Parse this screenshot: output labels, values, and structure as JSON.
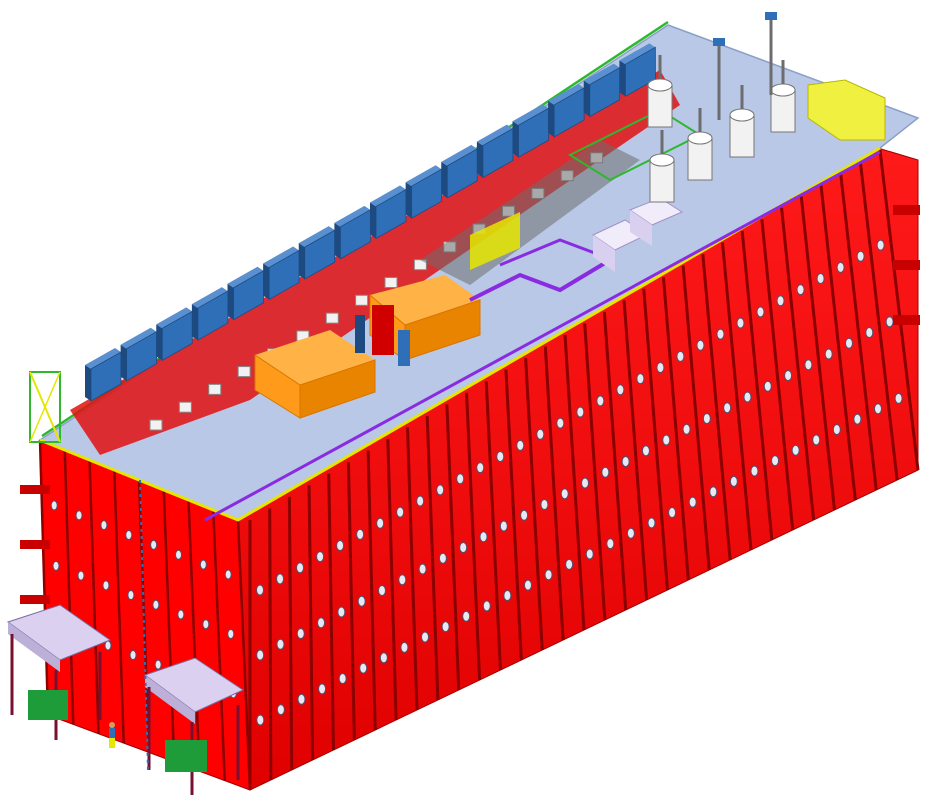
{
  "figure": {
    "kind": "isometric-3d-model",
    "background": "#ffffff"
  },
  "colors": {
    "frame_red": "#ff0000",
    "frame_red_dark": "#c80000",
    "frame_red_shadow": "#8c0000",
    "roof_deck": "#b8c8e6",
    "roof_deck_edge": "#8aa0c8",
    "equipment_blue": "#2f6fb8",
    "equipment_blue_dark": "#1d4a80",
    "enclosure_orange": "#ff9a1a",
    "enclosure_orange_dark": "#d97500",
    "railing_yellow": "#e6e600",
    "railing_green": "#2db82d",
    "pipe_purple": "#8a2be2",
    "tank_white": "#f2f2f2",
    "gray_steel": "#6d6d6d",
    "window_lilac": "#c9b8e8",
    "canopy_lilac": "#dcd0f0",
    "pump_green": "#1e9c3a",
    "porthole_white": "#e8e8f0"
  },
  "icons": [
    "cooling-unit-icon",
    "storage-tank-icon",
    "porthole-icon",
    "stair-tower-icon",
    "loading-canopy-icon",
    "human-figure-icon"
  ]
}
